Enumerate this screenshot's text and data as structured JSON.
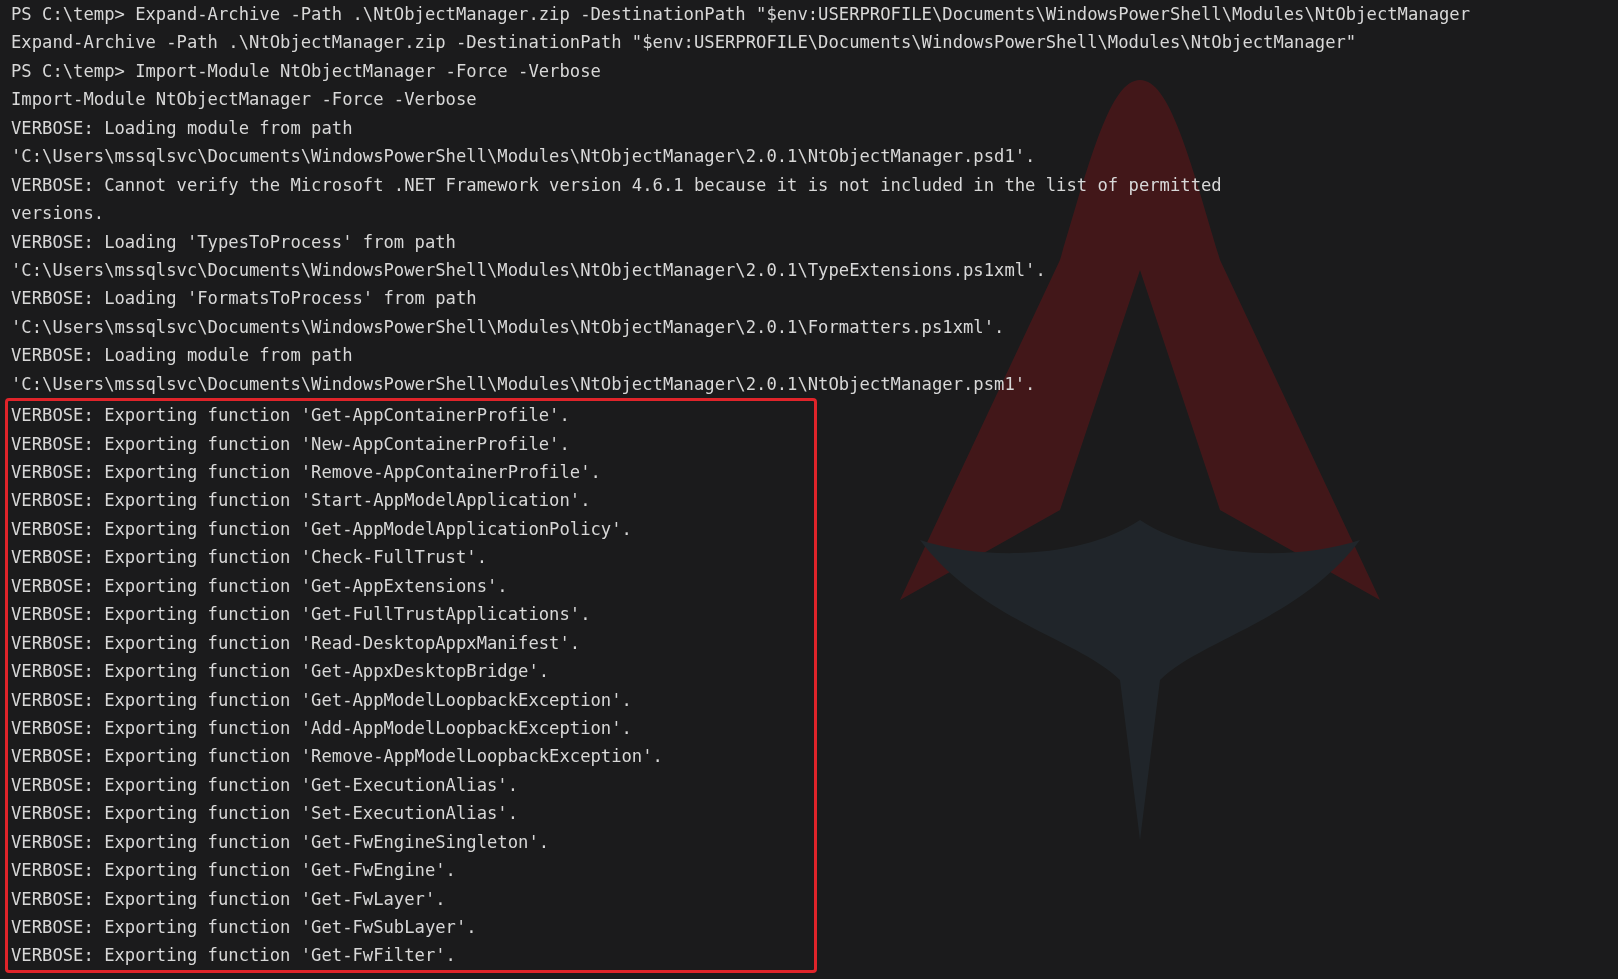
{
  "terminal": {
    "lines": [
      "PS C:\\temp> Expand-Archive -Path .\\NtObjectManager.zip -DestinationPath \"$env:USERPROFILE\\Documents\\WindowsPowerShell\\Modules\\NtObjectManager",
      "Expand-Archive -Path .\\NtObjectManager.zip -DestinationPath \"$env:USERPROFILE\\Documents\\WindowsPowerShell\\Modules\\NtObjectManager\"",
      "PS C:\\temp> Import-Module NtObjectManager -Force -Verbose",
      "Import-Module NtObjectManager -Force -Verbose",
      "VERBOSE: Loading module from path",
      "'C:\\Users\\mssqlsvc\\Documents\\WindowsPowerShell\\Modules\\NtObjectManager\\2.0.1\\NtObjectManager.psd1'.",
      "VERBOSE: Cannot verify the Microsoft .NET Framework version 4.6.1 because it is not included in the list of permitted",
      "versions.",
      "VERBOSE: Loading 'TypesToProcess' from path",
      "'C:\\Users\\mssqlsvc\\Documents\\WindowsPowerShell\\Modules\\NtObjectManager\\2.0.1\\TypeExtensions.ps1xml'.",
      "VERBOSE: Loading 'FormatsToProcess' from path",
      "'C:\\Users\\mssqlsvc\\Documents\\WindowsPowerShell\\Modules\\NtObjectManager\\2.0.1\\Formatters.ps1xml'.",
      "VERBOSE: Loading module from path",
      "'C:\\Users\\mssqlsvc\\Documents\\WindowsPowerShell\\Modules\\NtObjectManager\\2.0.1\\NtObjectManager.psm1'."
    ],
    "highlighted_lines": [
      "VERBOSE: Exporting function 'Get-AppContainerProfile'.",
      "VERBOSE: Exporting function 'New-AppContainerProfile'.",
      "VERBOSE: Exporting function 'Remove-AppContainerProfile'.",
      "VERBOSE: Exporting function 'Start-AppModelApplication'.",
      "VERBOSE: Exporting function 'Get-AppModelApplicationPolicy'.",
      "VERBOSE: Exporting function 'Check-FullTrust'.",
      "VERBOSE: Exporting function 'Get-AppExtensions'.",
      "VERBOSE: Exporting function 'Get-FullTrustApplications'.",
      "VERBOSE: Exporting function 'Read-DesktopAppxManifest'.",
      "VERBOSE: Exporting function 'Get-AppxDesktopBridge'.",
      "VERBOSE: Exporting function 'Get-AppModelLoopbackException'.",
      "VERBOSE: Exporting function 'Add-AppModelLoopbackException'.",
      "VERBOSE: Exporting function 'Remove-AppModelLoopbackException'.",
      "VERBOSE: Exporting function 'Get-ExecutionAlias'.",
      "VERBOSE: Exporting function 'Set-ExecutionAlias'.",
      "VERBOSE: Exporting function 'Get-FwEngineSingleton'.",
      "VERBOSE: Exporting function 'Get-FwEngine'.",
      "VERBOSE: Exporting function 'Get-FwLayer'.",
      "VERBOSE: Exporting function 'Get-FwSubLayer'.",
      "VERBOSE: Exporting function 'Get-FwFilter'."
    ]
  }
}
